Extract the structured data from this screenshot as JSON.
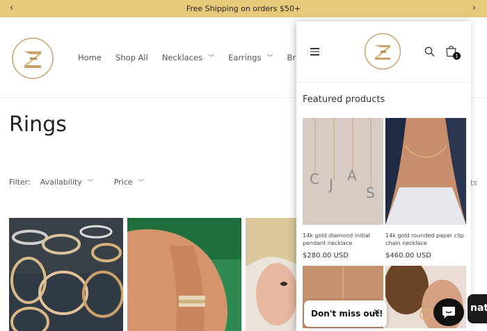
{
  "announcement": {
    "text": "Free Shipping on orders $50+"
  },
  "nav": {
    "items": [
      {
        "label": "Home"
      },
      {
        "label": "Shop All"
      },
      {
        "label": "Necklaces"
      },
      {
        "label": "Earrings"
      },
      {
        "label": "Bracelets"
      }
    ]
  },
  "page": {
    "title": "Rings"
  },
  "filter": {
    "label": "Filter:",
    "availability": "Availability",
    "price": "Price",
    "count": "ts"
  },
  "drawer": {
    "cart_count": "1",
    "featured_title": "Featured products",
    "products": [
      {
        "name": "14k gold diamond initial pendant necklace",
        "price": "$280.00 USD"
      },
      {
        "name": "14k gold rounded paper clip chain necklace",
        "price": "$460.00 USD"
      }
    ]
  },
  "popup": {
    "text": "Don't miss out!",
    "close": "✕"
  },
  "chat": {
    "text": "nat"
  },
  "colors": {
    "announcement_bg": "#e8c97c",
    "logo_gold": "#c9a36a"
  }
}
